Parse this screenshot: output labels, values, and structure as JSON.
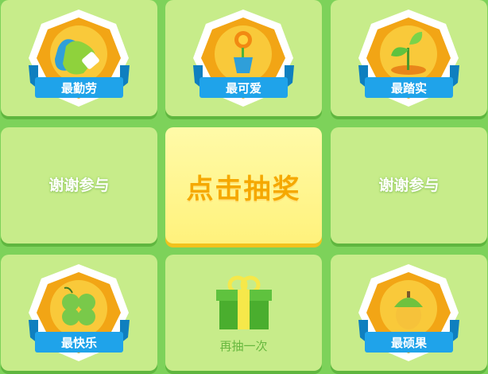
{
  "colors": {
    "background": "#7dd25a",
    "tile": "#c7ec8a",
    "center_tile": "#fff27c",
    "draw_text": "#f5a800",
    "ribbon": "#1fa3ea"
  },
  "tiles": [
    {
      "type": "badge",
      "label": "最勤劳",
      "icon": "gloves-icon"
    },
    {
      "type": "badge",
      "label": "最可爱",
      "icon": "flower-pot-icon"
    },
    {
      "type": "badge",
      "label": "最踏实",
      "icon": "sprout-icon"
    },
    {
      "type": "thanks",
      "label": "谢谢参与"
    },
    {
      "type": "draw",
      "label": "点击抽奖"
    },
    {
      "type": "thanks",
      "label": "谢谢参与"
    },
    {
      "type": "badge",
      "label": "最快乐",
      "icon": "clover-icon"
    },
    {
      "type": "retry",
      "label": "再抽一次",
      "icon": "gift-box-icon"
    },
    {
      "type": "badge",
      "label": "最硕果",
      "icon": "acorn-icon"
    }
  ]
}
